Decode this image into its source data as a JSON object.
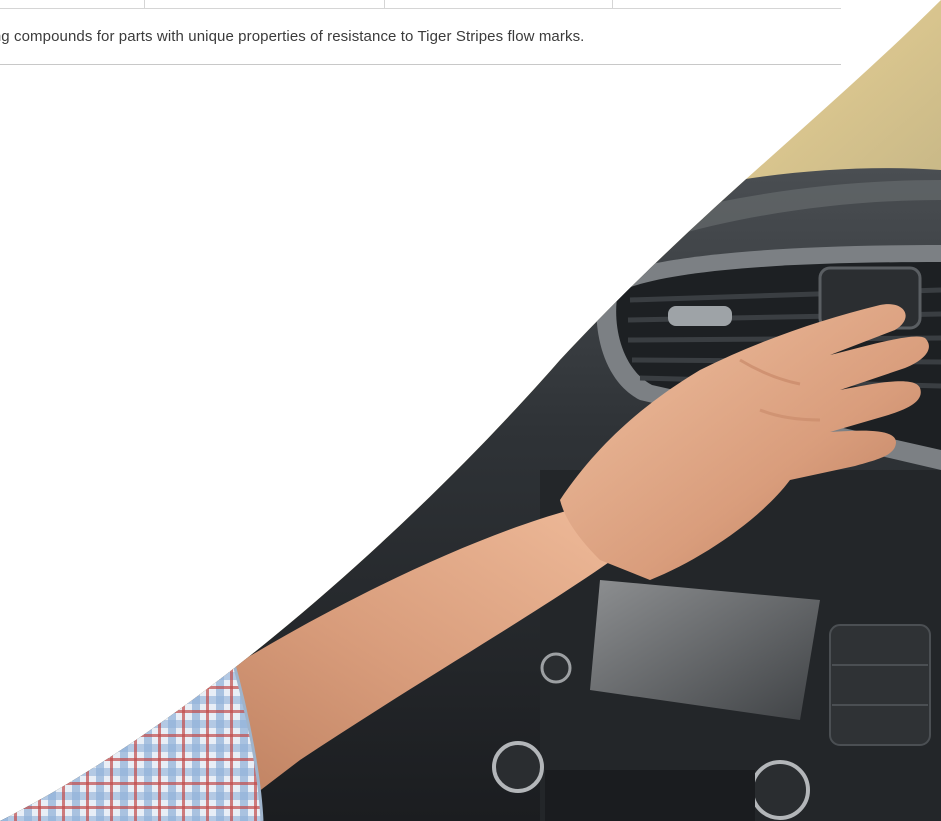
{
  "table": {
    "columns": [
      "",
      "",
      "",
      "",
      ""
    ]
  },
  "description": {
    "text": "ling compounds for parts with unique properties of resistance to Tiger Stripes flow marks."
  },
  "hero_image": {
    "subject": "hand-on-car-air-vent-photo"
  },
  "colors": {
    "text": "#3b3b3b",
    "rule": "#c8c8c8",
    "background": "#ffffff"
  }
}
